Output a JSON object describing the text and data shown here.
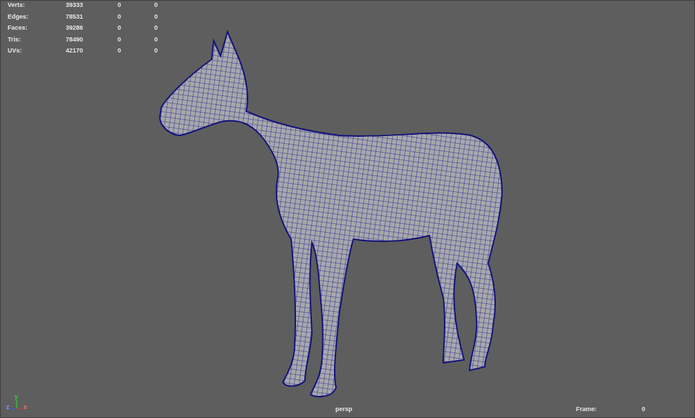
{
  "stats": [
    {
      "label": "Verts:",
      "values": [
        "39333",
        "0",
        "0"
      ]
    },
    {
      "label": "Edges:",
      "values": [
        "78531",
        "0",
        "0"
      ]
    },
    {
      "label": "Faces:",
      "values": [
        "39286",
        "0",
        "0"
      ]
    },
    {
      "label": "Tris:",
      "values": [
        "78490",
        "0",
        "0"
      ]
    },
    {
      "label": "UVs:",
      "values": [
        "42170",
        "0",
        "0"
      ]
    }
  ],
  "axis_gizmo": {
    "y": "y",
    "z": "z",
    "x": "x"
  },
  "camera": "persp",
  "frame": {
    "label": "Frame:",
    "value": "0"
  }
}
